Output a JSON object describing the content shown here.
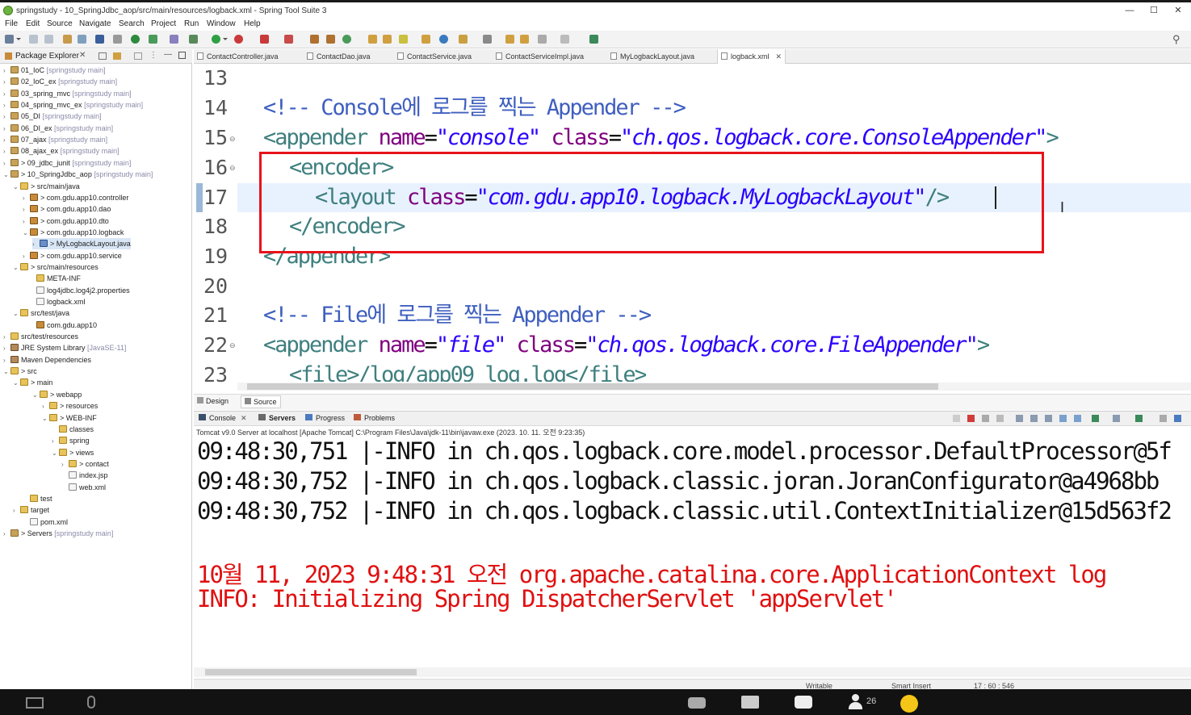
{
  "window": {
    "title": "springstudy - 10_SpringJdbc_aop/src/main/resources/logback.xml - Spring Tool Suite 3",
    "minimize": "—",
    "maximize": "☐",
    "close": "✕"
  },
  "menu": [
    "File",
    "Edit",
    "Source",
    "Navigate",
    "Search",
    "Project",
    "Run",
    "Window",
    "Help"
  ],
  "explorer": {
    "tab_label": "Package Explorer",
    "items": [
      {
        "arrow": "›",
        "icon": "proj",
        "name": "01_IoC",
        "suffix": "[springstudy main]"
      },
      {
        "arrow": "›",
        "icon": "proj",
        "name": "02_IoC_ex",
        "suffix": "[springstudy main]"
      },
      {
        "arrow": "›",
        "icon": "proj",
        "name": "03_spring_mvc",
        "suffix": "[springstudy main]"
      },
      {
        "arrow": "›",
        "icon": "proj",
        "name": "04_spring_mvc_ex",
        "suffix": "[springstudy main]"
      },
      {
        "arrow": "›",
        "icon": "proj",
        "name": "05_DI",
        "suffix": "[springstudy main]"
      },
      {
        "arrow": "›",
        "icon": "proj",
        "name": "06_DI_ex",
        "suffix": "[springstudy main]"
      },
      {
        "arrow": "›",
        "icon": "proj",
        "name": "07_ajax",
        "suffix": "[springstudy main]"
      },
      {
        "arrow": "›",
        "icon": "proj",
        "name": "08_ajax_ex",
        "suffix": "[springstudy main]"
      },
      {
        "arrow": "›",
        "icon": "proj",
        "name": "> 09_jdbc_junit",
        "suffix": "[springstudy main]"
      },
      {
        "arrow": "⌄",
        "icon": "proj",
        "name": "> 10_SpringJdbc_aop",
        "suffix": "[springstudy main]"
      },
      {
        "arrow": "⌄",
        "icon": "folder",
        "name": "> src/main/java",
        "suffix": ""
      },
      {
        "arrow": "›",
        "icon": "pkg",
        "name": "> com.gdu.app10.controller",
        "suffix": ""
      },
      {
        "arrow": "›",
        "icon": "pkg",
        "name": "> com.gdu.app10.dao",
        "suffix": ""
      },
      {
        "arrow": "›",
        "icon": "pkg",
        "name": "> com.gdu.app10.dto",
        "suffix": ""
      },
      {
        "arrow": "⌄",
        "icon": "pkg",
        "name": "> com.gdu.app10.logback",
        "suffix": ""
      },
      {
        "arrow": "›",
        "icon": "java",
        "name": "> MyLogbackLayout.java",
        "suffix": ""
      },
      {
        "arrow": "›",
        "icon": "pkg",
        "name": "> com.gdu.app10.service",
        "suffix": ""
      },
      {
        "arrow": "⌄",
        "icon": "folder",
        "name": "> src/main/resources",
        "suffix": ""
      },
      {
        "arrow": "",
        "icon": "folder",
        "name": "META-INF",
        "suffix": ""
      },
      {
        "arrow": "",
        "icon": "file",
        "name": "log4jdbc.log4j2.properties",
        "suffix": ""
      },
      {
        "arrow": "",
        "icon": "file",
        "name": "logback.xml",
        "suffix": ""
      },
      {
        "arrow": "⌄",
        "icon": "folder",
        "name": "src/test/java",
        "suffix": ""
      },
      {
        "arrow": "",
        "icon": "pkg",
        "name": "com.gdu.app10",
        "suffix": ""
      },
      {
        "arrow": "›",
        "icon": "folder",
        "name": "src/test/resources",
        "suffix": ""
      },
      {
        "arrow": "›",
        "icon": "lib",
        "name": "JRE System Library",
        "suffix": "[JavaSE-11]"
      },
      {
        "arrow": "›",
        "icon": "lib",
        "name": "Maven Dependencies",
        "suffix": ""
      },
      {
        "arrow": "⌄",
        "icon": "folder",
        "name": "> src",
        "suffix": ""
      },
      {
        "arrow": "⌄",
        "icon": "folder",
        "name": "> main",
        "suffix": ""
      },
      {
        "arrow": "⌄",
        "icon": "folder",
        "name": "> webapp",
        "suffix": ""
      },
      {
        "arrow": "›",
        "icon": "folder",
        "name": "> resources",
        "suffix": ""
      },
      {
        "arrow": "⌄",
        "icon": "folder",
        "name": "> WEB-INF",
        "suffix": ""
      },
      {
        "arrow": "",
        "icon": "folder",
        "name": "classes",
        "suffix": ""
      },
      {
        "arrow": "›",
        "icon": "folder",
        "name": "spring",
        "suffix": ""
      },
      {
        "arrow": "⌄",
        "icon": "folder",
        "name": "> views",
        "suffix": ""
      },
      {
        "arrow": "›",
        "icon": "folder",
        "name": "> contact",
        "suffix": ""
      },
      {
        "arrow": "",
        "icon": "file",
        "name": "index.jsp",
        "suffix": ""
      },
      {
        "arrow": "",
        "icon": "file",
        "name": "web.xml",
        "suffix": ""
      },
      {
        "arrow": "",
        "icon": "folder",
        "name": "test",
        "suffix": ""
      },
      {
        "arrow": "›",
        "icon": "folder",
        "name": "target",
        "suffix": ""
      },
      {
        "arrow": "",
        "icon": "file",
        "name": "pom.xml",
        "suffix": ""
      },
      {
        "arrow": "›",
        "icon": "proj",
        "name": "> Servers",
        "suffix": "[springstudy main]"
      }
    ]
  },
  "editor_tabs": [
    "ContactController.java",
    "ContactDao.java",
    "ContactService.java",
    "ContactServiceImpl.java",
    "MyLogbackLayout.java",
    "logback.xml"
  ],
  "editor_tabs_active": "logback.xml",
  "code": {
    "line_numbers": [
      "13",
      "14",
      "15",
      "16",
      "17",
      "18",
      "19",
      "20",
      "21",
      "22",
      "23"
    ],
    "comment1": "<!-- Console에 로그를 찍는 Appender -->",
    "l15_open": "<appender ",
    "l15_attr1": "name",
    "l15_val1": "\"console\"",
    "l15_attr2": "class",
    "l15_val2": "\"ch.qos.logback.core.ConsoleAppender\"",
    "l15_close": ">",
    "l16": "<encoder>",
    "l17_open": "<layout ",
    "l17_attr": "class",
    "l17_val": "\"com.gdu.app10.logback.MyLogbackLayout\"",
    "l17_close": "/>",
    "l18": "</encoder>",
    "l19": "</appender>",
    "comment2": "<!-- File에 로그를 찍는 Appender -->",
    "l22_open": "<appender ",
    "l22_attr1": "name",
    "l22_val1": "\"file\"",
    "l22_attr2": "class",
    "l22_val2": "\"ch.qos.logback.core.FileAppender\"",
    "l22_close": ">",
    "l23": "<file>/log/app09_log.log</file>",
    "eq": "="
  },
  "editor_mode_tabs": [
    "Design",
    "Source"
  ],
  "bottom_tabs": [
    "Console",
    "Servers",
    "Progress",
    "Problems"
  ],
  "console": {
    "header": "Tomcat v9.0 Server at localhost [Apache Tomcat] C:\\Program Files\\Java\\jdk-11\\bin\\javaw.exe  (2023. 10. 11. 오전 9:23:35)",
    "lines": [
      "09:48:30,751 |-INFO in ch.qos.logback.core.model.processor.DefaultProcessor@5f",
      "09:48:30,752 |-INFO in ch.qos.logback.classic.joran.JoranConfigurator@a4968bb",
      "09:48:30,752 |-INFO in ch.qos.logback.classic.util.ContextInitializer@15d563f2"
    ],
    "red_lines": [
      "10월 11, 2023 9:48:31 오전 org.apache.catalina.core.ApplicationContext log",
      "INFO: Initializing Spring DispatcherServlet 'appServlet'"
    ]
  },
  "status": {
    "writable": "Writable",
    "insert": "Smart Insert",
    "position": "17 : 60 : 546"
  },
  "taskbar": {
    "participants": "26"
  },
  "colors": {
    "highlight_box": "#e8131b",
    "console_red": "#e01010",
    "selection": "#d9e6f6"
  }
}
